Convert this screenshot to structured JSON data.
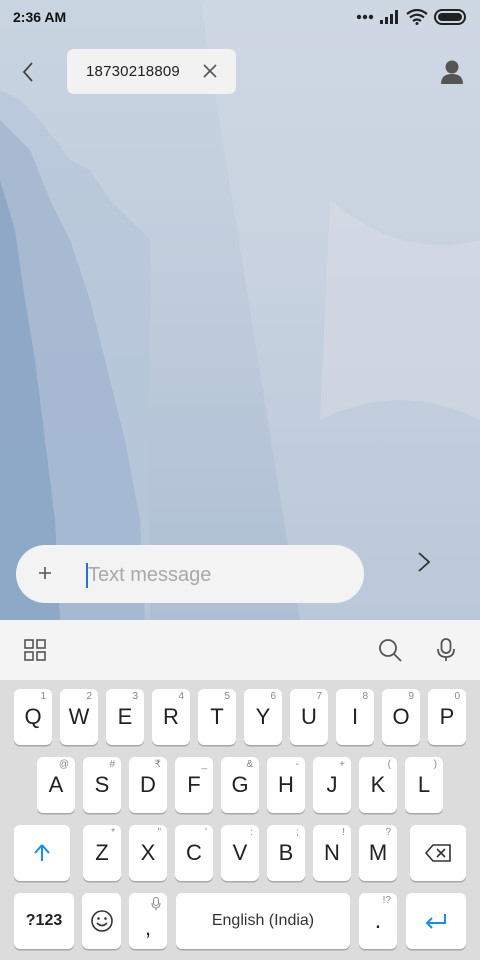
{
  "status_bar": {
    "time": "2:36 AM",
    "icons": [
      "dots-icon",
      "signal-icon",
      "wifi-icon",
      "battery-icon"
    ]
  },
  "header": {
    "back_icon": "chevron-left-icon",
    "recipient": "18730218809",
    "remove_icon": "close-icon",
    "contact_icon": "person-icon"
  },
  "compose": {
    "attach_icon": "plus-icon",
    "placeholder": "Text message",
    "value": "",
    "send_icon": "chevron-right-icon"
  },
  "keyboard_toolbar": {
    "icons": [
      "grid-icon",
      "search-icon",
      "microphone-icon"
    ]
  },
  "keyboard": {
    "row1": [
      {
        "key": "Q",
        "hint": "1"
      },
      {
        "key": "W",
        "hint": "2"
      },
      {
        "key": "E",
        "hint": "3"
      },
      {
        "key": "R",
        "hint": "4"
      },
      {
        "key": "T",
        "hint": "5"
      },
      {
        "key": "Y",
        "hint": "6"
      },
      {
        "key": "U",
        "hint": "7"
      },
      {
        "key": "I",
        "hint": "8"
      },
      {
        "key": "O",
        "hint": "9"
      },
      {
        "key": "P",
        "hint": "0"
      }
    ],
    "row2": [
      {
        "key": "A",
        "hint": "@"
      },
      {
        "key": "S",
        "hint": "#"
      },
      {
        "key": "D",
        "hint": "₹"
      },
      {
        "key": "F",
        "hint": "_"
      },
      {
        "key": "G",
        "hint": "&"
      },
      {
        "key": "H",
        "hint": "-"
      },
      {
        "key": "J",
        "hint": "+"
      },
      {
        "key": "K",
        "hint": "("
      },
      {
        "key": "L",
        "hint": ")"
      }
    ],
    "row3": [
      {
        "key": "Z",
        "hint": "*"
      },
      {
        "key": "X",
        "hint": "\""
      },
      {
        "key": "C",
        "hint": "'"
      },
      {
        "key": "V",
        "hint": ":"
      },
      {
        "key": "B",
        "hint": ";"
      },
      {
        "key": "N",
        "hint": "!"
      },
      {
        "key": "M",
        "hint": "?"
      }
    ],
    "shift_icon": "shift-arrow-icon",
    "backspace_icon": "backspace-icon",
    "symbols_label": "?123",
    "emoji_icon": "smiley-icon",
    "comma_label": ",",
    "space_label": "English (India)",
    "period_label": ".",
    "period_hint": "!?",
    "enter_icon": "enter-arrow-icon",
    "accent_color": "#1a8fe3"
  }
}
